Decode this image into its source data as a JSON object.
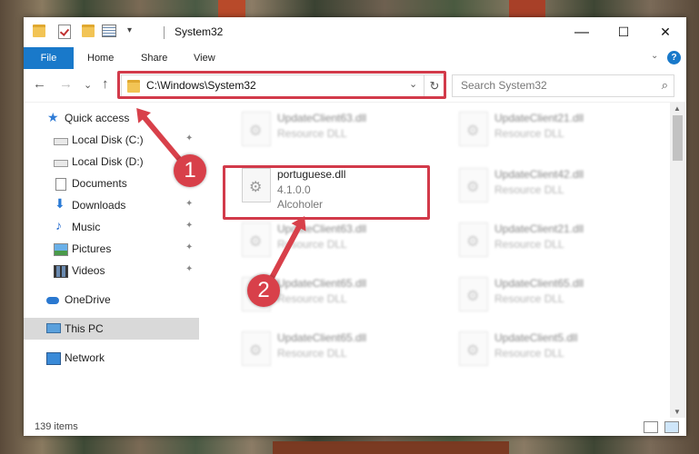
{
  "window": {
    "title": "System32",
    "controls": {
      "minimize": "—",
      "maximize": "☐",
      "close": "✕"
    }
  },
  "ribbon": {
    "tabs": [
      "File",
      "Home",
      "Share",
      "View"
    ],
    "collapse": "⌄",
    "help": "?"
  },
  "navigation": {
    "back": "←",
    "forward": "→",
    "recent": "⌄",
    "up": "↑",
    "address": "C:\\Windows\\System32",
    "search_placeholder": "Search System32"
  },
  "sidebar": {
    "items": [
      {
        "label": "Quick access",
        "icon": "star-icon",
        "pinned": false
      },
      {
        "label": "Local Disk (C:)",
        "icon": "disk-icon",
        "pinned": true
      },
      {
        "label": "Local Disk (D:)",
        "icon": "disk-icon",
        "pinned": false
      },
      {
        "label": "Documents",
        "icon": "documents-icon",
        "pinned": true
      },
      {
        "label": "Downloads",
        "icon": "downloads-icon",
        "pinned": true
      },
      {
        "label": "Music",
        "icon": "music-icon",
        "pinned": true
      },
      {
        "label": "Pictures",
        "icon": "pictures-icon",
        "pinned": true
      },
      {
        "label": "Videos",
        "icon": "videos-icon",
        "pinned": true
      },
      {
        "label": "OneDrive",
        "icon": "onedrive-icon",
        "pinned": false
      },
      {
        "label": "This PC",
        "icon": "pc-icon",
        "pinned": false,
        "selected": true
      },
      {
        "label": "Network",
        "icon": "network-icon",
        "pinned": false
      }
    ],
    "pin_glyph": "📌"
  },
  "files": [
    {
      "name": "UpdateClient63.dll",
      "desc": "Resource DLL",
      "faded": true
    },
    {
      "name": "UpdateClient21.dll",
      "desc": "Resource DLL",
      "faded": true
    },
    {
      "name": "portuguese.dll",
      "desc": "4.1.0.0",
      "desc2": "Alcoholer",
      "faded": false
    },
    {
      "name": "UpdateClient42.dll",
      "desc": "Resource DLL",
      "faded": true
    },
    {
      "name": "UpdateClient63.dll",
      "desc": "Resource DLL",
      "faded": true
    },
    {
      "name": "UpdateClient21.dll",
      "desc": "Resource DLL",
      "faded": true
    },
    {
      "name": "UpdateClient65.dll",
      "desc": "Resource DLL",
      "faded": true
    },
    {
      "name": "UpdateClient65.dll",
      "desc": "Resource DLL",
      "faded": true
    },
    {
      "name": "UpdateClient65.dll",
      "desc": "Resource DLL",
      "faded": true
    },
    {
      "name": "UpdateClient5.dll",
      "desc": "Resource DLL",
      "faded": true
    }
  ],
  "status": {
    "count": "139 items"
  },
  "callouts": [
    "1",
    "2"
  ],
  "colors": {
    "accent": "#1979ca",
    "highlight": "#d23a4a",
    "selection": "#d9d9d9"
  }
}
